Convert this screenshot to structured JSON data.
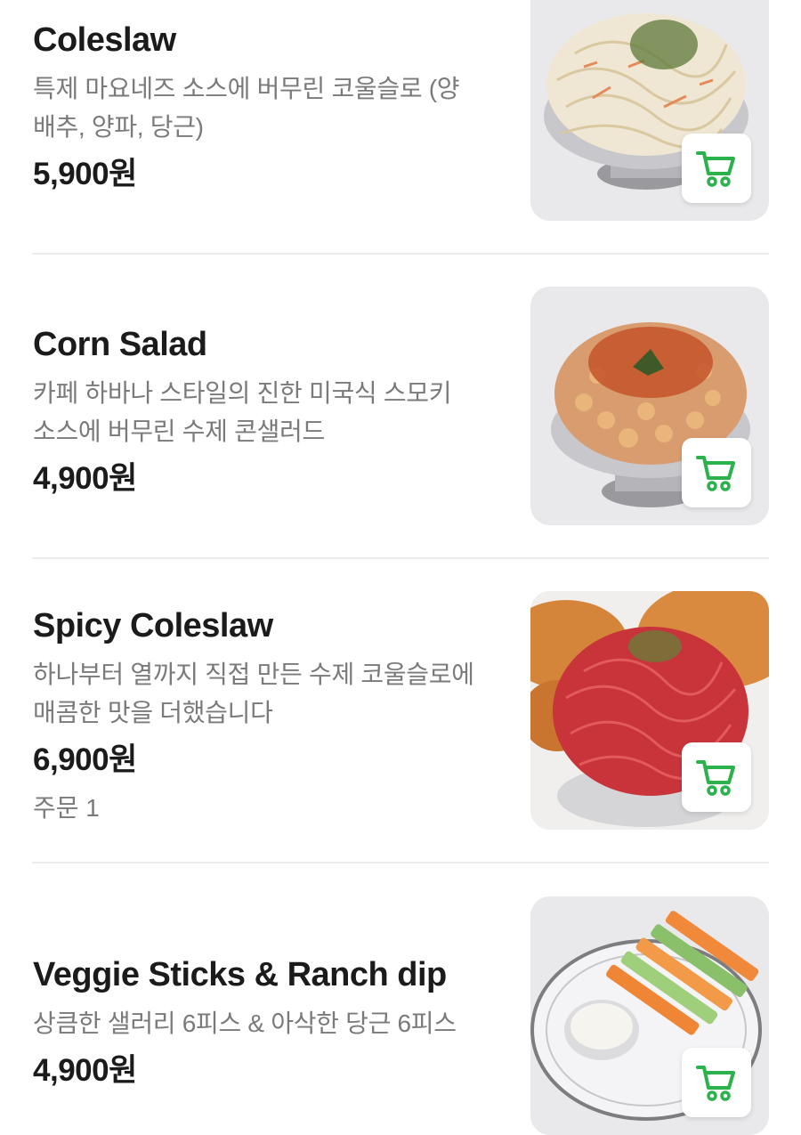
{
  "menu": {
    "items": [
      {
        "name": "Coleslaw",
        "description": "특제 마요네즈 소스에 버무린 코울슬로 (양배추, 양파, 당근)",
        "price": "5,900원",
        "image_icon": "coleslaw-photo",
        "cart_icon": "cart-icon"
      },
      {
        "name": "Corn Salad",
        "description": "카페 하바나 스타일의 진한 미국식 스모키 소스에 버무린 수제 콘샐러드",
        "price": "4,900원",
        "image_icon": "corn-salad-photo",
        "cart_icon": "cart-icon"
      },
      {
        "name": "Spicy Coleslaw",
        "description": "하나부터 열까지 직접 만든 수제 코울슬로에 매콤한 맛을 더했습니다",
        "price": "6,900원",
        "orders": "주문 1",
        "image_icon": "spicy-coleslaw-photo",
        "cart_icon": "cart-icon"
      },
      {
        "name": "Veggie Sticks & Ranch dip",
        "description": "상큼한 샐러리 6피스 & 아삭한 당근 6피스",
        "price": "4,900원",
        "image_icon": "veggie-sticks-photo",
        "cart_icon": "cart-icon"
      }
    ]
  },
  "colors": {
    "accent_green": "#2bb24c",
    "text_primary": "#1b1b1b",
    "text_secondary": "#7a7a7a",
    "divider": "#ececec"
  }
}
